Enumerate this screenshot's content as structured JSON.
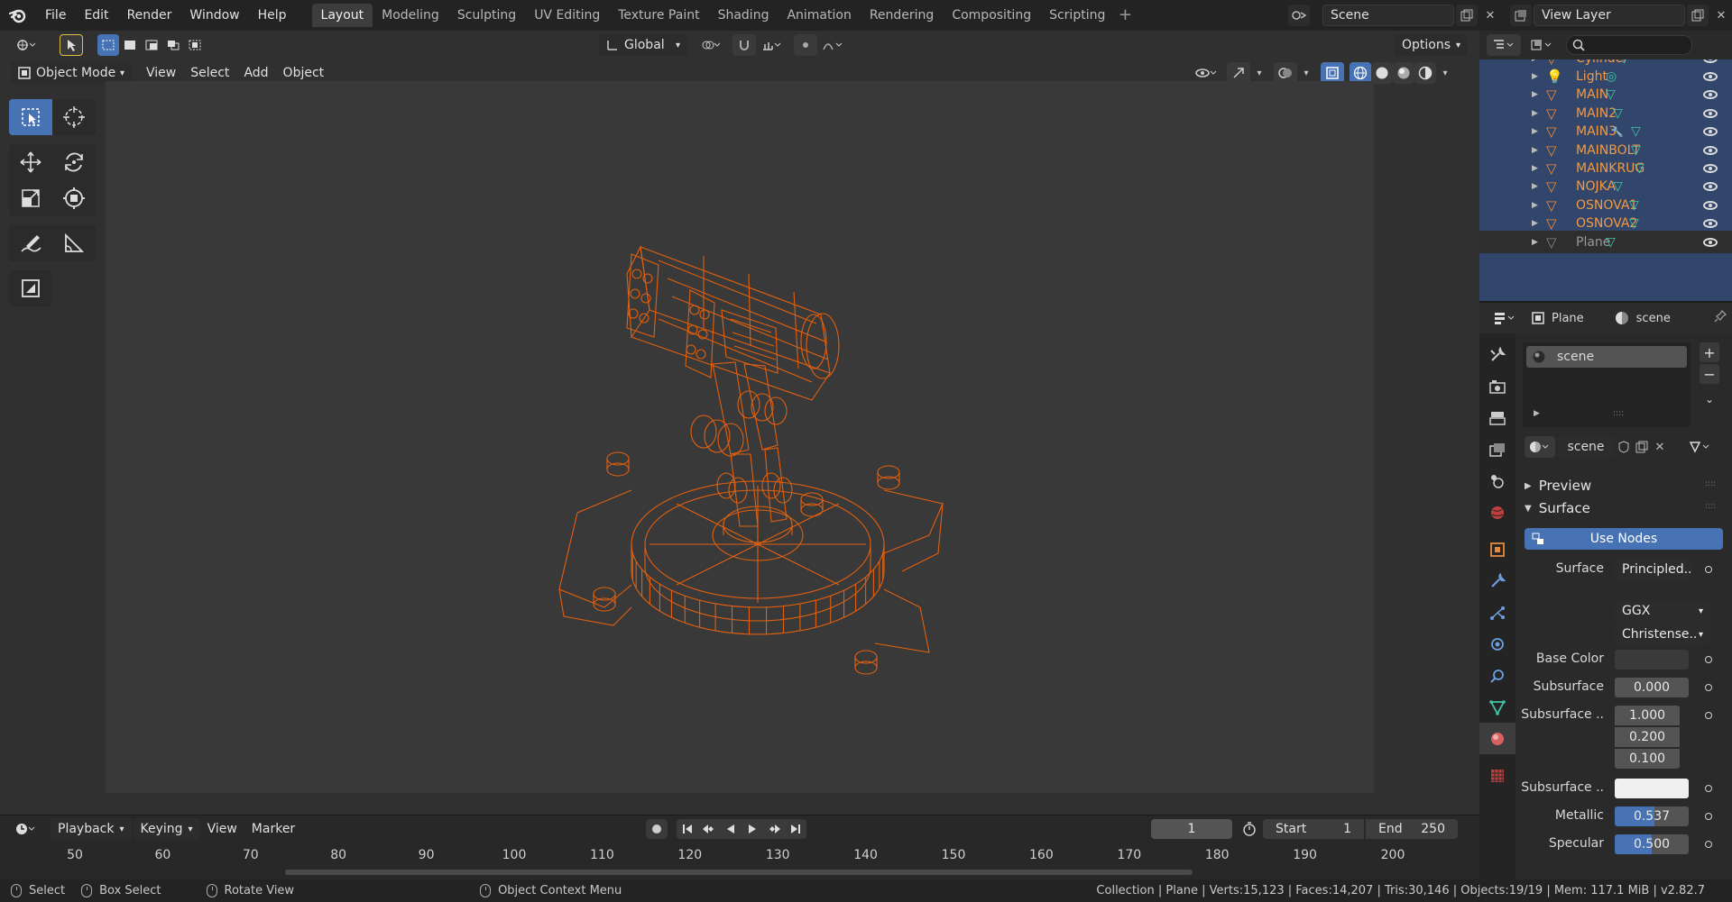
{
  "topbar": {
    "menus": [
      "File",
      "Edit",
      "Render",
      "Window",
      "Help"
    ],
    "workspaces": [
      "Layout",
      "Modeling",
      "Sculpting",
      "UV Editing",
      "Texture Paint",
      "Shading",
      "Animation",
      "Rendering",
      "Compositing",
      "Scripting"
    ],
    "active_workspace": "Layout",
    "scene_name": "Scene",
    "view_layer": "View Layer"
  },
  "viewport": {
    "orientation": "Global",
    "options_label": "Options",
    "mode": "Object Mode",
    "menus": [
      "View",
      "Select",
      "Add",
      "Object"
    ],
    "wire_color": "#e06010"
  },
  "timeline": {
    "menus": [
      "Playback",
      "Keying",
      "View",
      "Marker"
    ],
    "current_frame": "1",
    "start_label": "Start",
    "start_value": "1",
    "end_label": "End",
    "end_value": "250",
    "ticks": [
      "50",
      "60",
      "70",
      "80",
      "90",
      "100",
      "110",
      "120",
      "130",
      "140",
      "150",
      "160",
      "170",
      "180",
      "190",
      "200"
    ]
  },
  "statusbar": {
    "select": "Select",
    "box_select": "Box Select",
    "rotate_view": "Rotate View",
    "context_menu": "Object Context Menu",
    "stats": "Collection | Plane | Verts:15,123 | Faces:14,207 | Tris:30,146 | Objects:19/19 | Mem: 117.1 MiB | v2.82.7"
  },
  "outliner": {
    "items": [
      {
        "name": "Cylinder",
        "data_icon": "mesh-data-icon"
      },
      {
        "name": "Light",
        "data_icon": "light-data-icon"
      },
      {
        "name": "MAIN",
        "data_icon": "mesh-data-icon"
      },
      {
        "name": "MAIN2",
        "data_icon": "mesh-data-icon"
      },
      {
        "name": "MAIN3",
        "data_icon": "mesh-data-icon"
      },
      {
        "name": "MAINBOLT",
        "data_icon": "mesh-data-icon"
      },
      {
        "name": "MAINKRUG",
        "data_icon": "mesh-data-icon"
      },
      {
        "name": "NOJKA",
        "data_icon": "mesh-data-icon"
      },
      {
        "name": "OSNOVA1",
        "data_icon": "mesh-data-icon"
      },
      {
        "name": "OSNOVA2",
        "data_icon": "mesh-data-icon"
      },
      {
        "name": "Plane",
        "data_icon": "mesh-data-icon"
      }
    ]
  },
  "properties": {
    "object_name": "Plane",
    "material_name": "scene",
    "slot_name": "scene",
    "datablock_name": "scene",
    "preview_label": "Preview",
    "surface_panel_label": "Surface",
    "use_nodes_label": "Use Nodes",
    "surface_label": "Surface",
    "surface_value": "Principled..",
    "distribution": "GGX",
    "subsurface_method": "Christense..",
    "base_color_label": "Base Color",
    "subsurface_label": "Subsurface",
    "subsurface_value": "0.000",
    "subsurface_radius_label": "Subsurface ..",
    "subsurface_radius": [
      "1.000",
      "0.200",
      "0.100"
    ],
    "subsurface_color_label": "Subsurface ..",
    "metallic_label": "Metallic",
    "metallic_value": "0.537",
    "specular_label": "Specular",
    "specular_value": "0.500",
    "accent_color": "#4772b3"
  }
}
